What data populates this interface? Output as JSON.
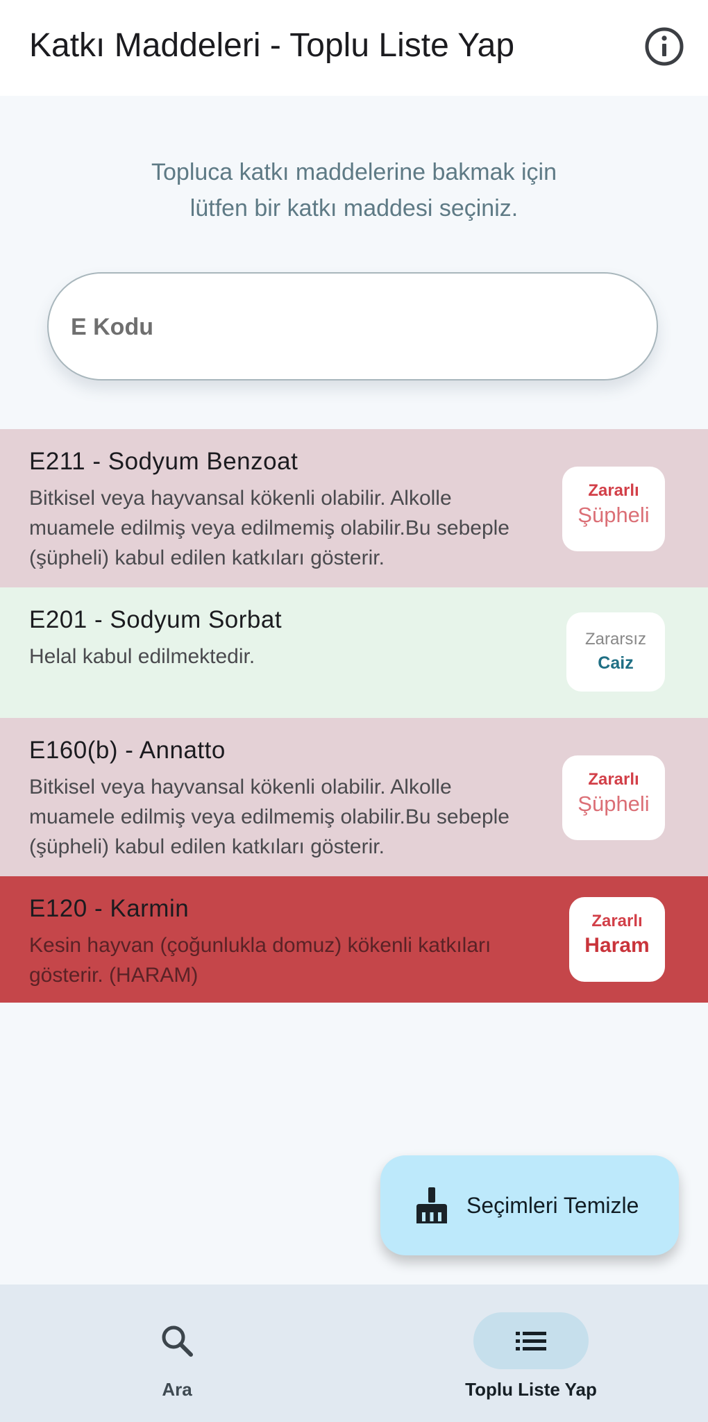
{
  "app_bar": {
    "title": "Katkı Maddeleri - Toplu Liste Yap",
    "info_icon": "info-circle-icon"
  },
  "intro": {
    "line1": "Topluca katkı maddelerine bakmak için",
    "line2": "lütfen bir katkı maddesi seçiniz."
  },
  "search": {
    "placeholder": "E Kodu",
    "value": ""
  },
  "items": [
    {
      "title": "E211 - Sodyum Benzoat",
      "description": "Bitkisel veya hayvansal kökenli olabilir. Alkolle muamele edilmiş veya edilmemiş olabilir.Bu sebeple (şüpheli) kabul edilen katkıları gösterir.",
      "health": "Zararlı",
      "status": "Şüpheli"
    },
    {
      "title": "E201 - Sodyum Sorbat",
      "description": "Helal kabul edilmektedir.",
      "health": "Zararsız",
      "status": "Caiz"
    },
    {
      "title": "E160(b) - Annatto",
      "description": "Bitkisel veya hayvansal kökenli olabilir. Alkolle muamele edilmiş veya edilmemiş olabilir.Bu sebeple (şüpheli) kabul edilen katkıları gösterir.",
      "health": "Zararlı",
      "status": "Şüpheli"
    },
    {
      "title": "E120 - Karmin",
      "description": "Kesin hayvan (çoğunlukla domuz) kökenli katkıları gösterir. (HARAM)",
      "health": "Zararlı",
      "status": "Haram"
    }
  ],
  "fab": {
    "label": "Seçimleri Temizle",
    "icon": "broom-icon"
  },
  "bottom_nav": {
    "items": [
      {
        "label": "Ara",
        "icon": "search-icon",
        "selected": false
      },
      {
        "label": "Toplu Liste Yap",
        "icon": "list-icon",
        "selected": true
      }
    ]
  },
  "colors": {
    "suspect_bg": "#e4d1d6",
    "allowed_bg": "#e7f4ea",
    "forbidden_bg": "#c5464a",
    "fab_bg": "#bde9fb",
    "navbar_bg": "#e1e9f1"
  }
}
